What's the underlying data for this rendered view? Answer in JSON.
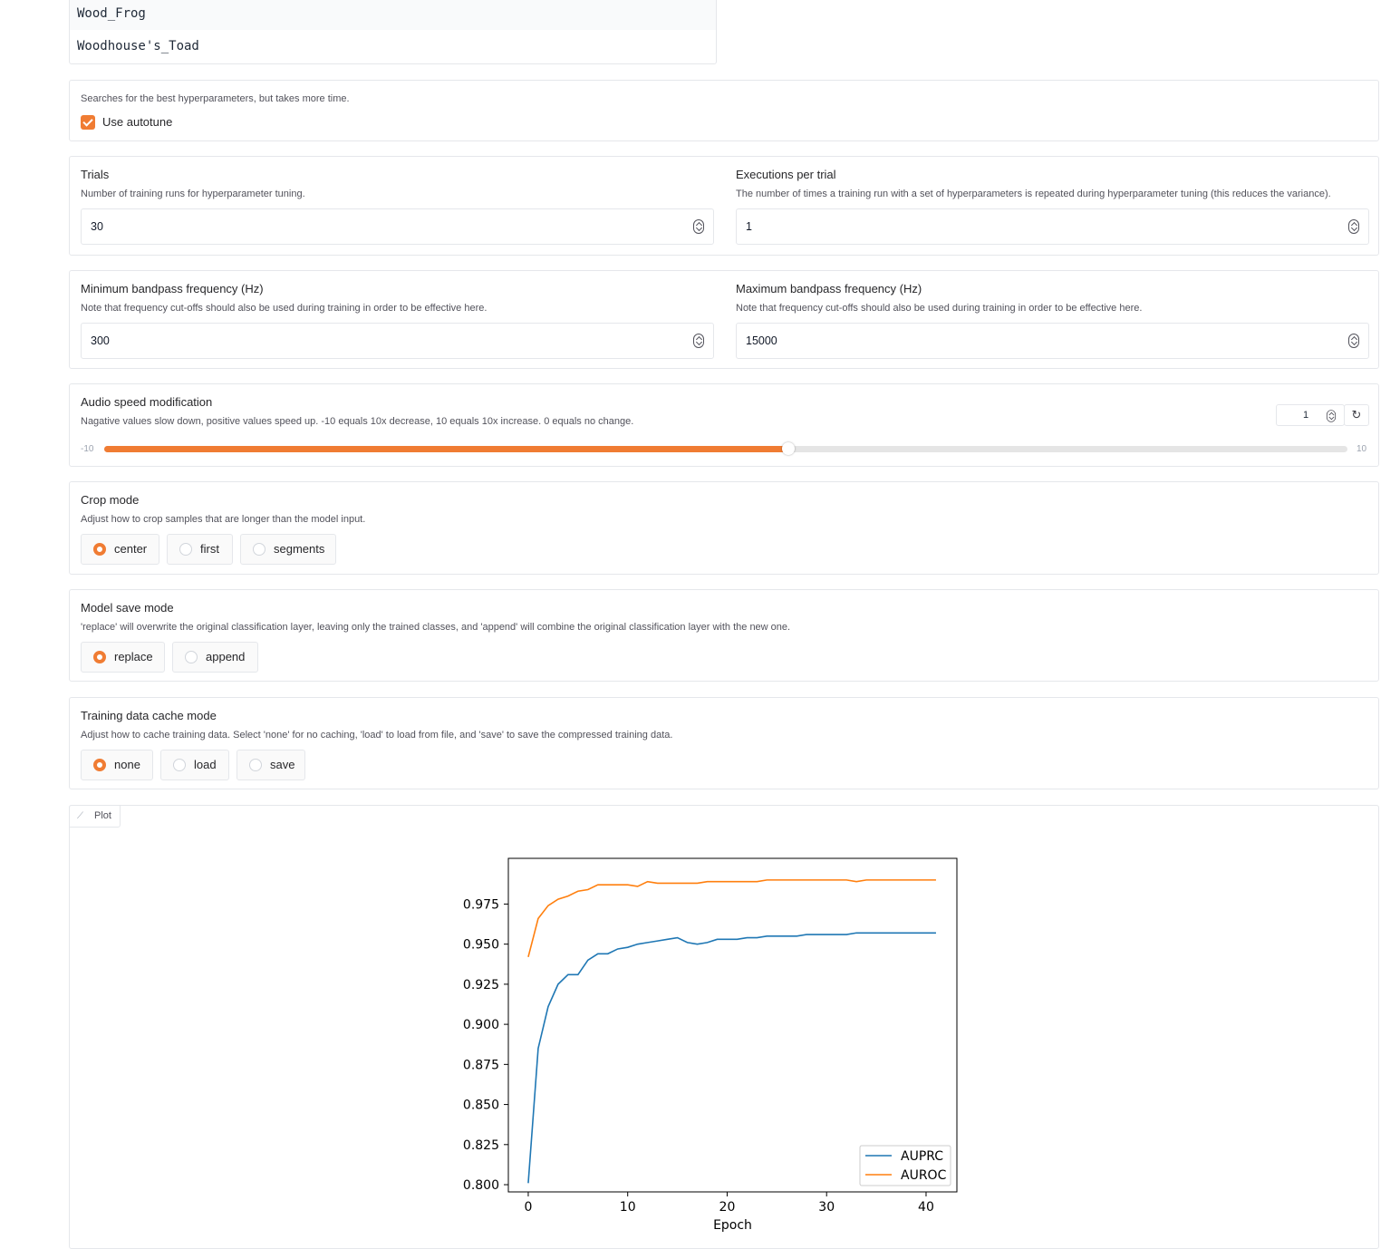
{
  "class_list": [
    "Wood_Frog",
    "Woodhouse's_Toad"
  ],
  "autotune": {
    "info": "Searches for the best hyperparameters, but takes more time.",
    "label": "Use autotune",
    "checked": true
  },
  "trials": {
    "label": "Trials",
    "info": "Number of training runs for hyperparameter tuning.",
    "value": "30"
  },
  "executions": {
    "label": "Executions per trial",
    "info": "The number of times a training run with a set of hyperparameters is repeated during hyperparameter tuning (this reduces the variance).",
    "value": "1"
  },
  "min_bandpass": {
    "label": "Minimum bandpass frequency (Hz)",
    "info": "Note that frequency cut-offs should also be used during training in order to be effective here.",
    "value": "300"
  },
  "max_bandpass": {
    "label": "Maximum bandpass frequency (Hz)",
    "info": "Note that frequency cut-offs should also be used during training in order to be effective here.",
    "value": "15000"
  },
  "audio_speed": {
    "label": "Audio speed modification",
    "info": "Nagative values slow down, positive values speed up. -10 equals 10x decrease, 10 equals 10x increase. 0 equals no change.",
    "value": "1",
    "min": "-10",
    "max": "10",
    "fraction": 0.55
  },
  "crop_mode": {
    "label": "Crop mode",
    "info": "Adjust how to crop samples that are longer than the model input.",
    "options": [
      "center",
      "first",
      "segments"
    ],
    "selected": "center"
  },
  "model_save_mode": {
    "label": "Model save mode",
    "info": "'replace' will overwrite the original classification layer, leaving only the trained classes, and 'append' will combine the original classification layer with the new one.",
    "options": [
      "replace",
      "append"
    ],
    "selected": "replace"
  },
  "cache_mode": {
    "label": "Training data cache mode",
    "info": "Adjust how to cache training data. Select 'none' for no caching, 'load' to load from file, and 'save' to save the compressed training data.",
    "options": [
      "none",
      "load",
      "save"
    ],
    "selected": "none"
  },
  "plot": {
    "tab_label": "Plot"
  },
  "chart_data": {
    "type": "line",
    "xlabel": "Epoch",
    "ylabel": "",
    "xlim": [
      -2,
      43.1
    ],
    "ylim": [
      0.7955,
      1.0035
    ],
    "xticks": [
      0,
      10,
      20,
      30,
      40
    ],
    "yticks": [
      0.8,
      0.825,
      0.85,
      0.875,
      0.9,
      0.925,
      0.95,
      0.975
    ],
    "ytick_labels": [
      "0.800",
      "0.825",
      "0.850",
      "0.875",
      "0.900",
      "0.925",
      "0.950",
      "0.975"
    ],
    "legend_position": "lower-right",
    "grid": false,
    "x": [
      0,
      1,
      2,
      3,
      4,
      5,
      6,
      7,
      8,
      9,
      10,
      11,
      12,
      13,
      14,
      15,
      16,
      17,
      18,
      19,
      20,
      21,
      22,
      23,
      24,
      25,
      26,
      27,
      28,
      29,
      30,
      31,
      32,
      33,
      34,
      35,
      36,
      37,
      38,
      39,
      40,
      41
    ],
    "series": [
      {
        "name": "AUPRC",
        "color": "#1f77b4",
        "values": [
          0.801,
          0.885,
          0.911,
          0.925,
          0.931,
          0.931,
          0.94,
          0.944,
          0.944,
          0.947,
          0.948,
          0.95,
          0.951,
          0.952,
          0.953,
          0.954,
          0.951,
          0.95,
          0.951,
          0.953,
          0.953,
          0.953,
          0.954,
          0.954,
          0.955,
          0.955,
          0.955,
          0.955,
          0.956,
          0.956,
          0.956,
          0.956,
          0.956,
          0.957,
          0.957,
          0.957,
          0.957,
          0.957,
          0.957,
          0.957,
          0.957,
          0.957
        ]
      },
      {
        "name": "AUROC",
        "color": "#ff7f0e",
        "values": [
          0.942,
          0.966,
          0.974,
          0.978,
          0.98,
          0.983,
          0.984,
          0.987,
          0.987,
          0.987,
          0.987,
          0.986,
          0.989,
          0.988,
          0.988,
          0.988,
          0.988,
          0.988,
          0.989,
          0.989,
          0.989,
          0.989,
          0.989,
          0.989,
          0.99,
          0.99,
          0.99,
          0.99,
          0.99,
          0.99,
          0.99,
          0.99,
          0.99,
          0.989,
          0.99,
          0.99,
          0.99,
          0.99,
          0.99,
          0.99,
          0.99,
          0.99
        ]
      }
    ]
  }
}
